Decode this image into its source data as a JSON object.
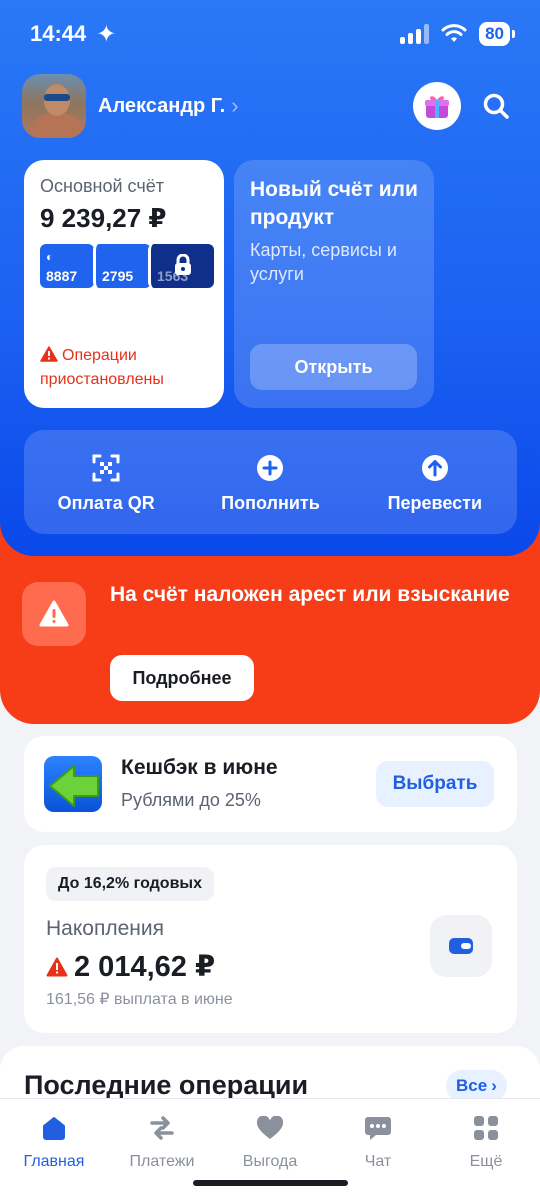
{
  "status_bar": {
    "time": "14:44",
    "battery": "80"
  },
  "profile": {
    "name": "Александр Г."
  },
  "main_account": {
    "label": "Основной счёт",
    "balance": "9 239,27 ₽",
    "cards": [
      "8887",
      "2795",
      "1563"
    ],
    "warning": "Операции приостановлены"
  },
  "new_account": {
    "title": "Новый счёт или продукт",
    "subtitle": "Карты, сервисы и услуги",
    "button": "Открыть"
  },
  "quick_actions": [
    {
      "label": "Оплата QR",
      "icon": "qr-icon"
    },
    {
      "label": "Пополнить",
      "icon": "plus-circle-icon"
    },
    {
      "label": "Перевести",
      "icon": "arrow-up-circle-icon"
    }
  ],
  "arrest_alert": {
    "text": "На счёт наложен арест или взыскание",
    "button": "Подробнее"
  },
  "cashback": {
    "title": "Кешбэк в июне",
    "subtitle": "Рублями до 25%",
    "button": "Выбрать"
  },
  "savings": {
    "badge": "До 16,2% годовых",
    "label": "Накопления",
    "amount": "2 014,62 ₽",
    "note": "161,56 ₽ выплата в июне"
  },
  "operations": {
    "title": "Последние операции",
    "all_button": "Все"
  },
  "tabbar": [
    {
      "label": "Главная",
      "icon": "home-icon",
      "active": true
    },
    {
      "label": "Платежи",
      "icon": "transfer-icon",
      "active": false
    },
    {
      "label": "Выгода",
      "icon": "heart-icon",
      "active": false
    },
    {
      "label": "Чат",
      "icon": "chat-icon",
      "active": false
    },
    {
      "label": "Ещё",
      "icon": "grid-icon",
      "active": false
    }
  ],
  "colors": {
    "primary": "#1C62F2",
    "alert": "#F73C18",
    "accent_text": "#1F5FE0"
  }
}
